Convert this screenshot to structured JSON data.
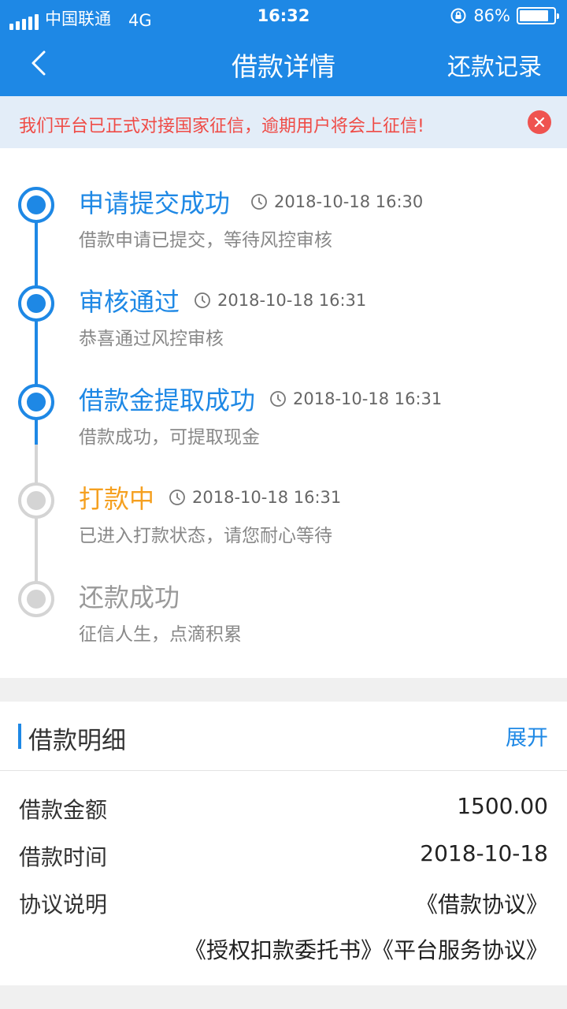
{
  "status_bar": {
    "carrier": "中国联通",
    "network": "4G",
    "time": "16:32",
    "battery": "86%",
    "battery_level": 0.86
  },
  "nav": {
    "title": "借款详情",
    "records_label": "还款记录"
  },
  "notice": {
    "text": "我们平台已正式对接国家征信，逾期用户将会上征信!"
  },
  "timeline": {
    "steps": [
      {
        "title": "申请提交成功",
        "time": "2018-10-18 16:30",
        "desc": "借款申请已提交，等待风控审核",
        "state": "done"
      },
      {
        "title": "审核通过",
        "time": "2018-10-18 16:31",
        "desc": "恭喜通过风控审核",
        "state": "done"
      },
      {
        "title": "借款金提取成功",
        "time": "2018-10-18 16:31",
        "desc": "借款成功，可提取现金",
        "state": "done"
      },
      {
        "title": "打款中",
        "time": "2018-10-18 16:31",
        "desc": "已进入打款状态，请您耐心等待",
        "state": "current"
      },
      {
        "title": "还款成功",
        "time": "",
        "desc": "征信人生，点滴积累",
        "state": "pending"
      }
    ]
  },
  "detail": {
    "title": "借款明细",
    "expand_label": "展开",
    "amount_label": "借款金额",
    "amount_value": "1500.00",
    "time_label": "借款时间",
    "time_value": "2018-10-18",
    "agreement_label": "协议说明",
    "agreements": [
      "《借款协议》",
      "《授权扣款委托书》",
      "《平台服务协议》"
    ]
  },
  "colors": {
    "primary": "#1e88e5",
    "warning_text": "#ef4b46",
    "current_step": "#f5a020",
    "pending": "#d4d4d4"
  }
}
